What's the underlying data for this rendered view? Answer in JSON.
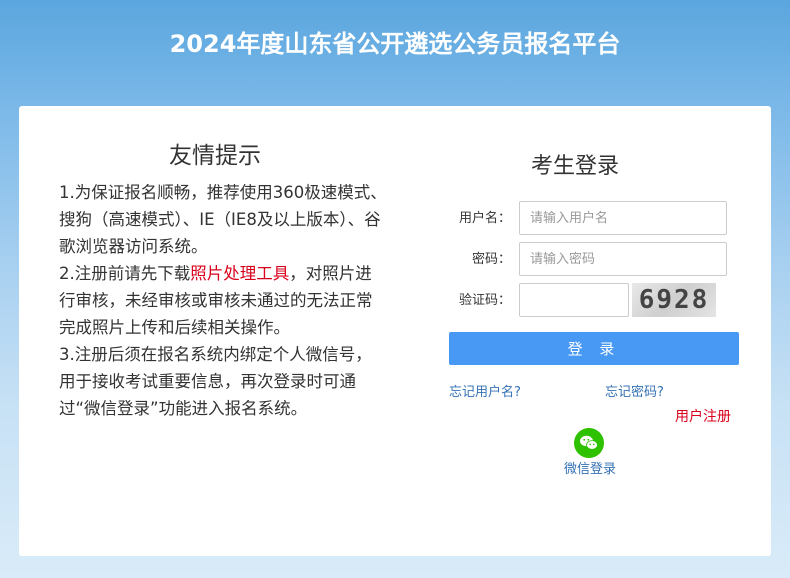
{
  "header": {
    "title": "2024年度山东省公开遴选公务员报名平台"
  },
  "notice": {
    "title": "友情提示",
    "item1": "1.为保证报名顺畅，推荐使用360极速模式、搜狗（高速模式）、IE（IE8及以上版本）、谷歌浏览器访问系统。",
    "item2_prefix": "2.注册前请先下载",
    "item2_link": "照片处理工具",
    "item2_suffix": "，对照片进行审核，未经审核或审核未通过的无法正常完成照片上传和后续相关操作。",
    "item3": "3.注册后须在报名系统内绑定个人微信号，用于接收考试重要信息，再次登录时可通过“微信登录”功能进入报名系统。"
  },
  "login": {
    "title": "考生登录",
    "username_label": "用户名：",
    "username_placeholder": "请输入用户名",
    "password_label": "密码：",
    "password_placeholder": "请输入密码",
    "captcha_label": "验证码：",
    "captcha_value": "",
    "captcha_text": "6928",
    "submit_label": "登 录",
    "forgot_username": "忘记用户名?",
    "forgot_password": "忘记密码?",
    "register": "用户注册",
    "wechat_login": "微信登录"
  },
  "colors": {
    "accent": "#4799f4",
    "link": "#3471b5",
    "warning_red": "#d9001b",
    "wechat_green": "#2ec100"
  }
}
